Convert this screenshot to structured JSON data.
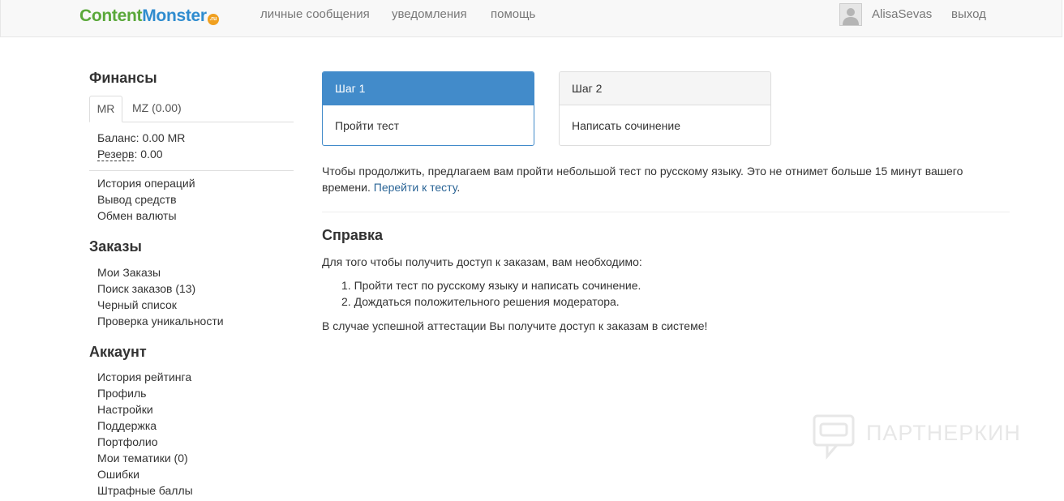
{
  "header": {
    "logo_part1": "Content",
    "logo_part2": "Monster",
    "logo_badge": ".ru",
    "nav": [
      "личные сообщения",
      "уведомления",
      "помощь"
    ],
    "username": "AlisaSevas",
    "logout": "выход"
  },
  "sidebar": {
    "finance_title": "Финансы",
    "tabs": [
      "MR",
      "MZ (0.00)"
    ],
    "balance_label": "Баланс:",
    "balance_value": "0.00 MR",
    "reserve_label": "Резерв",
    "reserve_value": ": 0.00",
    "finance_links": [
      "История операций",
      "Вывод средств",
      "Обмен валюты"
    ],
    "orders_title": "Заказы",
    "orders_links": [
      "Мои Заказы",
      "Поиск заказов (13)",
      "Черный список",
      "Проверка уникальности"
    ],
    "account_title": "Аккаунт",
    "account_links": [
      "История рейтинга",
      "Профиль",
      "Настройки",
      "Поддержка",
      "Портфолио",
      "Мои тематики (0)",
      "Ошибки",
      "Штрафные баллы"
    ]
  },
  "steps": [
    {
      "title": "Шаг 1",
      "text": "Пройти тест"
    },
    {
      "title": "Шаг 2",
      "text": "Написать сочинение"
    }
  ],
  "intro": {
    "line1": "Чтобы продолжить, предлагаем вам пройти небольшой тест по русскому языку. Это не отнимет больше 15 минут вашего",
    "line2_text": "времени.",
    "link": "Перейти к тесту",
    "line2_end": "."
  },
  "help": {
    "title": "Справка",
    "lead": "Для того чтобы получить доступ к заказам, вам необходимо:",
    "items": [
      "1. Пройти тест по русскому языку и написать сочинение.",
      "2. Дождаться положительного решения модератора."
    ],
    "footer": "В случае успешной аттестации Вы получите доступ к заказам в системе!"
  },
  "watermark": "ПАРТНЕРКИН",
  "colors": {
    "primary": "#428bca",
    "link": "#2a6496",
    "logo_green": "#5aa83a",
    "logo_blue": "#2f8ccf"
  }
}
